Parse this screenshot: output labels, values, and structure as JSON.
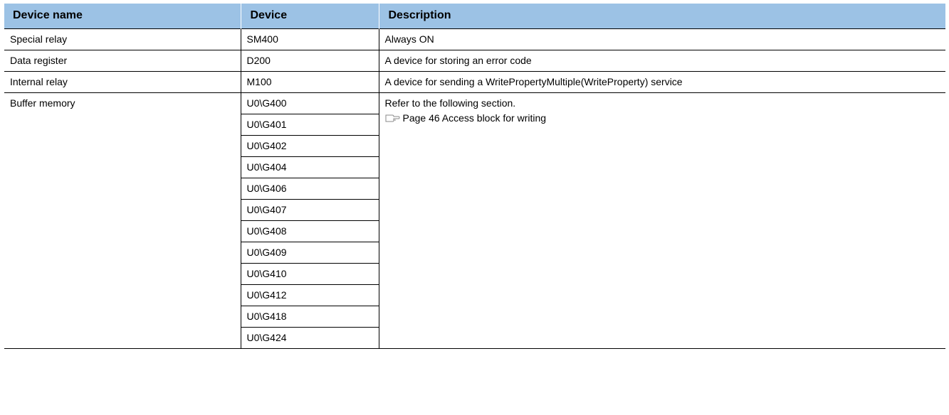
{
  "table": {
    "headers": [
      "Device name",
      "Device",
      "Description"
    ],
    "rows": [
      {
        "name": "Special relay",
        "device": "SM400",
        "description": "Always ON"
      },
      {
        "name": "Data register",
        "device": "D200",
        "description": "A device for storing an error code"
      },
      {
        "name": "Internal relay",
        "device": "M100",
        "description": "A device for sending a WritePropertyMultiple(WriteProperty) service"
      }
    ],
    "buffer_memory": {
      "name": "Buffer memory",
      "devices": [
        "U0\\G400",
        "U0\\G401",
        "U0\\G402",
        "U0\\G404",
        "U0\\G406",
        "U0\\G407",
        "U0\\G408",
        "U0\\G409",
        "U0\\G410",
        "U0\\G412",
        "U0\\G418",
        "U0\\G424"
      ],
      "description": "Refer to the following section.",
      "reference": "Page 46 Access block for writing",
      "reference_icon": "page-reference-icon"
    }
  },
  "colors": {
    "header_bg": "#9cc2e5",
    "border": "#000000"
  }
}
